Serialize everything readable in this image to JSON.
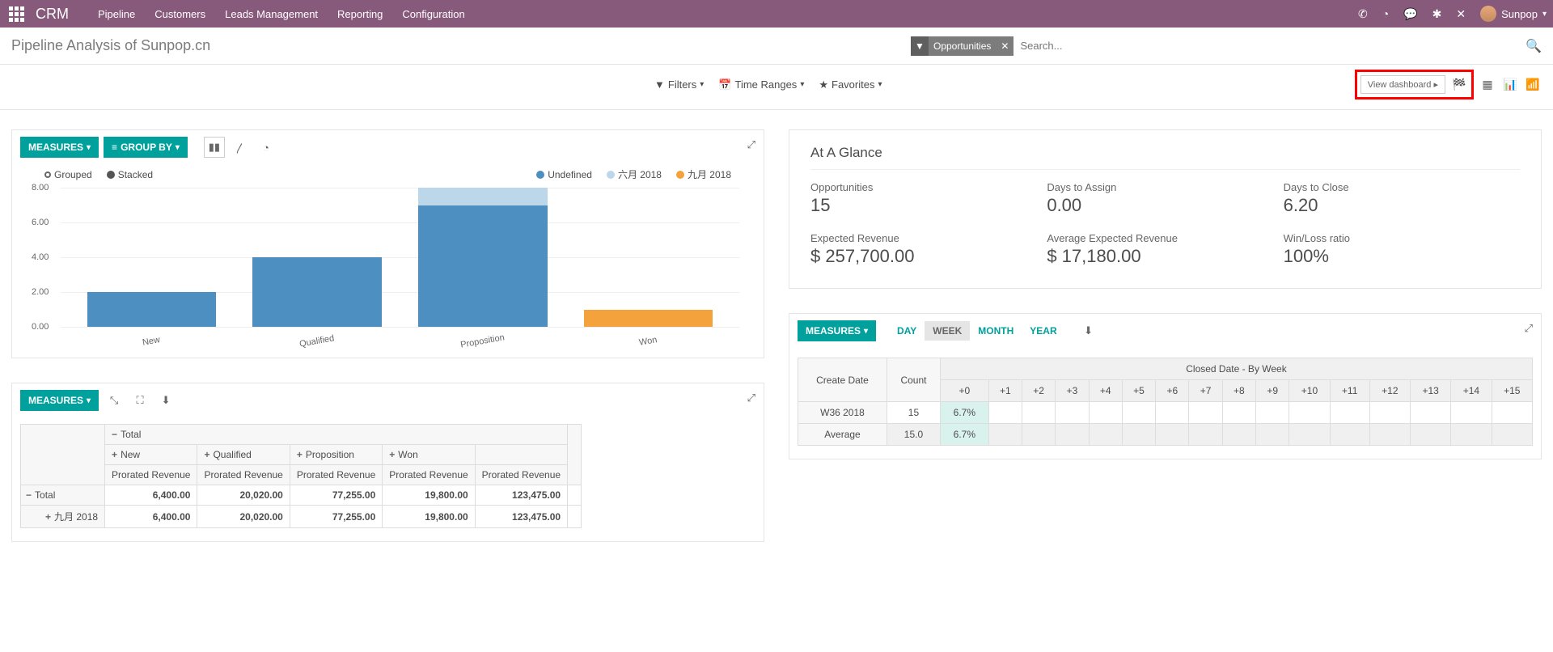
{
  "colors": {
    "teal": "#00a09d",
    "blue": "#4e8fc1",
    "lightblue": "#bcd6ea",
    "orange": "#f4a23c"
  },
  "topbar": {
    "brand": "CRM",
    "nav": [
      "Pipeline",
      "Customers",
      "Leads Management",
      "Reporting",
      "Configuration"
    ],
    "user": "Sunpop"
  },
  "page": {
    "title": "Pipeline Analysis of Sunpop.cn"
  },
  "search": {
    "facet_label": "Opportunities",
    "placeholder": "Search..."
  },
  "controls": {
    "filters": "Filters",
    "time_ranges": "Time Ranges",
    "favorites": "Favorites",
    "view_dashboard": "View dashboard"
  },
  "chartpanel": {
    "measures": "MEASURES",
    "groupby": "GROUP BY",
    "mode_grouped": "Grouped",
    "mode_stacked": "Stacked",
    "legend": [
      {
        "name": "Undefined",
        "color": "#4e8fc1"
      },
      {
        "name": "六月 2018",
        "color": "#bcd6ea"
      },
      {
        "name": "九月 2018",
        "color": "#f4a23c"
      }
    ]
  },
  "chart_data": {
    "type": "bar",
    "stacked": true,
    "ylabel": "",
    "ylim": [
      0,
      8
    ],
    "yticks": [
      0.0,
      2.0,
      4.0,
      6.0,
      8.0
    ],
    "categories": [
      "New",
      "Qualified",
      "Proposition",
      "Won"
    ],
    "series": [
      {
        "name": "Undefined",
        "color": "#4e8fc1",
        "values": [
          2,
          4,
          7,
          0
        ]
      },
      {
        "name": "六月 2018",
        "color": "#bcd6ea",
        "values": [
          0,
          0,
          1,
          0
        ]
      },
      {
        "name": "九月 2018",
        "color": "#f4a23c",
        "values": [
          0,
          0,
          0,
          1
        ]
      }
    ]
  },
  "glance": {
    "title": "At A Glance",
    "row1": [
      {
        "label": "Opportunities",
        "value": "15"
      },
      {
        "label": "Days to Assign",
        "value": "0.00"
      },
      {
        "label": "Days to Close",
        "value": "6.20"
      }
    ],
    "row2": [
      {
        "label": "Expected Revenue",
        "value": "$ 257,700.00"
      },
      {
        "label": "Average Expected Revenue",
        "value": "$ 17,180.00"
      },
      {
        "label": "Win/Loss ratio",
        "value": "100%"
      }
    ]
  },
  "pivot": {
    "measures": "MEASURES",
    "total": "Total",
    "cols": [
      "New",
      "Qualified",
      "Proposition",
      "Won"
    ],
    "measure_label": "Prorated Revenue",
    "rows": [
      {
        "label": "Total",
        "values": [
          "6,400.00",
          "20,020.00",
          "77,255.00",
          "19,800.00",
          "123,475.00"
        ],
        "expand": "−"
      },
      {
        "label": "九月 2018",
        "values": [
          "6,400.00",
          "20,020.00",
          "77,255.00",
          "19,800.00",
          "123,475.00"
        ],
        "expand": "+"
      }
    ]
  },
  "cohort": {
    "measures": "MEASURES",
    "tabs": [
      "DAY",
      "WEEK",
      "MONTH",
      "YEAR"
    ],
    "active_tab": "WEEK",
    "row_header": "Create Date",
    "count_header": "Count",
    "span_header": "Closed Date - By Week",
    "offsets": [
      "+0",
      "+1",
      "+2",
      "+3",
      "+4",
      "+5",
      "+6",
      "+7",
      "+8",
      "+9",
      "+10",
      "+11",
      "+12",
      "+13",
      "+14",
      "+15"
    ],
    "rows": [
      {
        "label": "W36 2018",
        "count": "15",
        "cells": [
          "6.7%",
          "",
          "",
          "",
          "",
          "",
          "",
          "",
          "",
          "",
          "",
          "",
          "",
          "",
          "",
          ""
        ]
      },
      {
        "label": "Average",
        "count": "15.0",
        "cells": [
          "6.7%",
          "",
          "",
          "",
          "",
          "",
          "",
          "",
          "",
          "",
          "",
          "",
          "",
          "",
          "",
          ""
        ]
      }
    ]
  }
}
